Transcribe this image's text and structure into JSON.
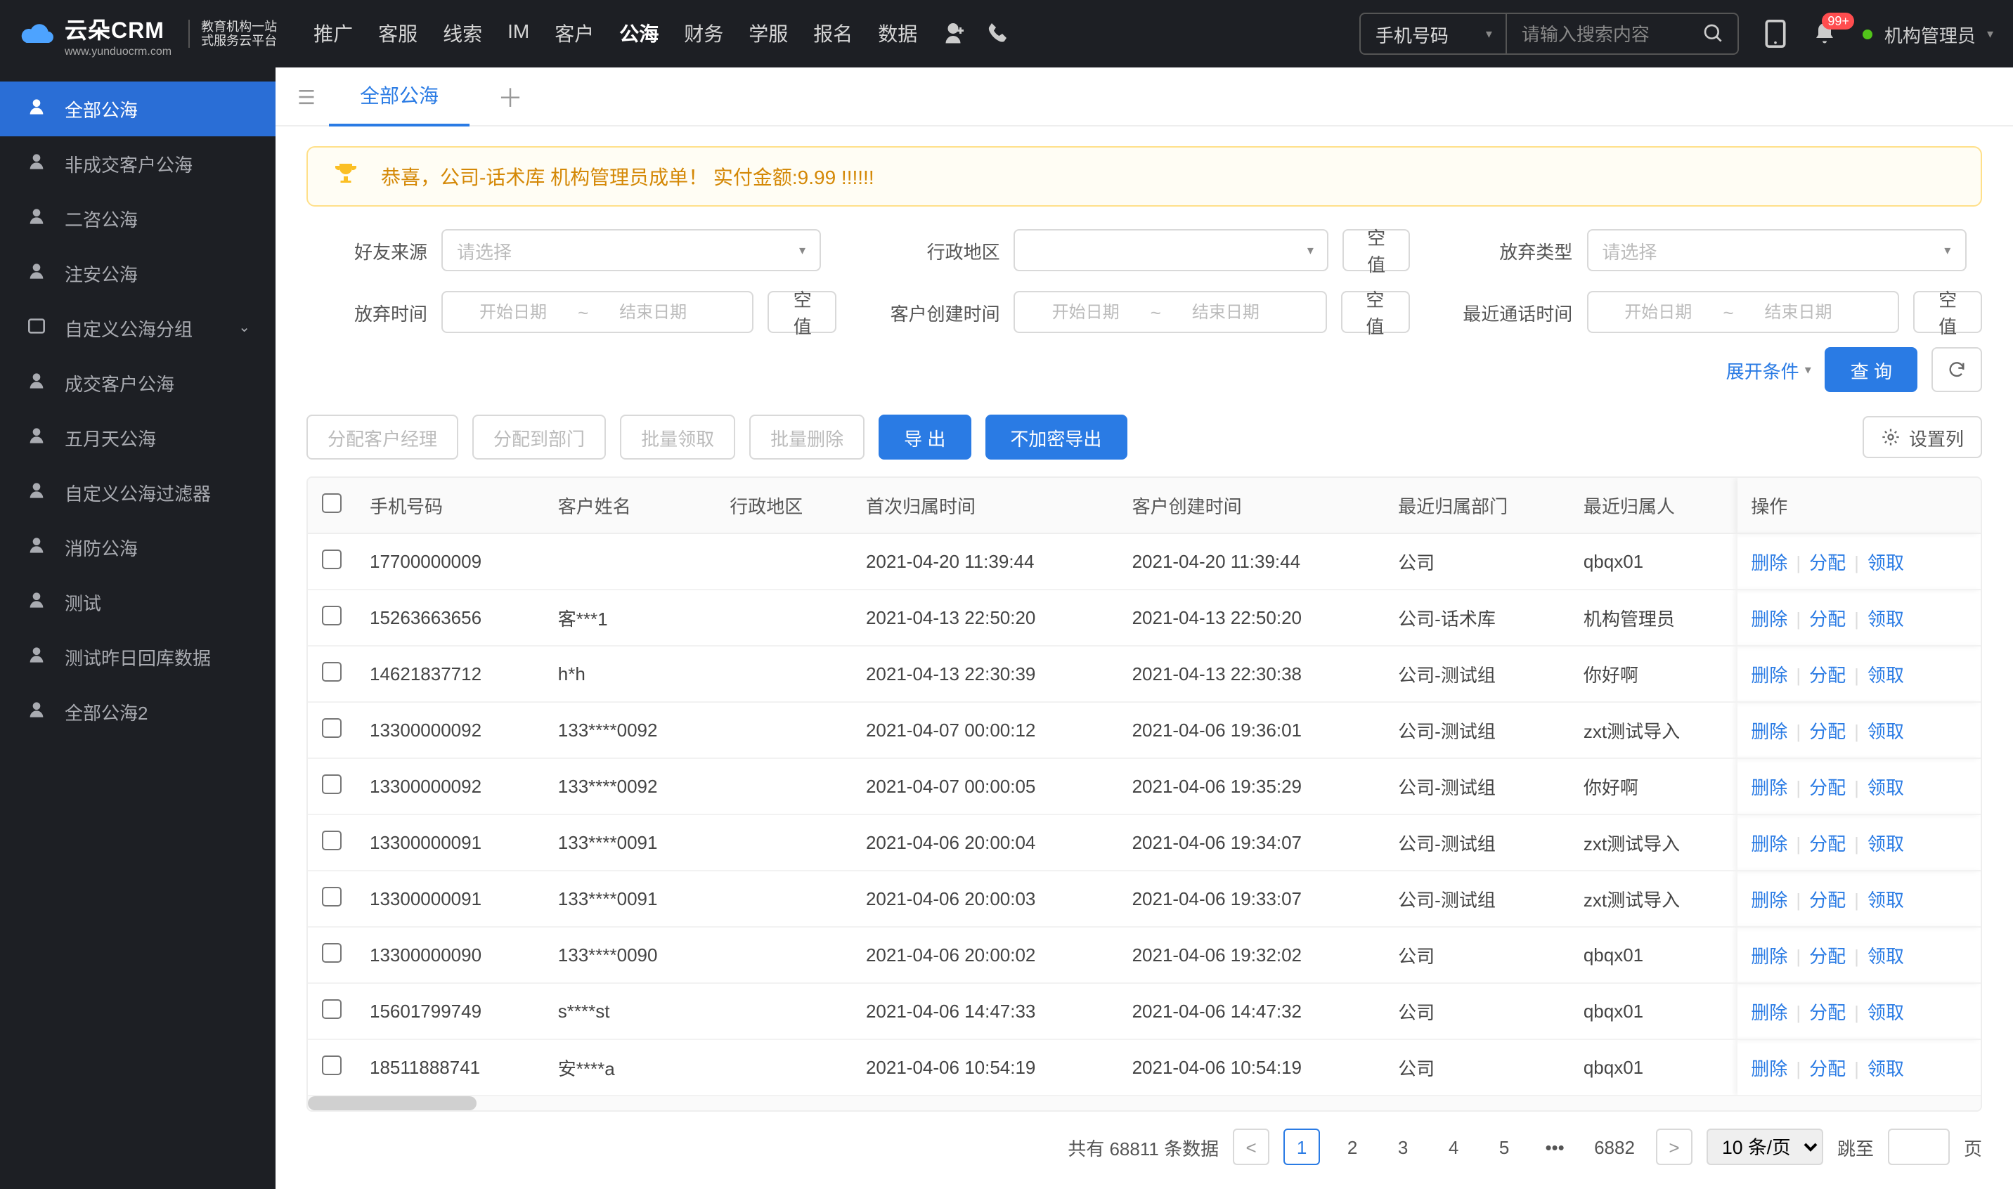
{
  "header": {
    "brand": "云朵CRM",
    "brand_url": "www.yunduocrm.com",
    "brand_sub1": "教育机构一站",
    "brand_sub2": "式服务云平台",
    "nav": [
      "推广",
      "客服",
      "线索",
      "IM",
      "客户",
      "公海",
      "财务",
      "学服",
      "报名",
      "数据"
    ],
    "nav_active": 5,
    "search_type": "手机号码",
    "search_placeholder": "请输入搜索内容",
    "notif_badge": "99+",
    "user_name": "机构管理员"
  },
  "sidebar": {
    "items": [
      {
        "label": "全部公海",
        "active": true
      },
      {
        "label": "非成交客户公海"
      },
      {
        "label": "二咨公海"
      },
      {
        "label": "注安公海"
      },
      {
        "label": "自定义公海分组",
        "expandable": true
      },
      {
        "label": "成交客户公海"
      },
      {
        "label": "五月天公海"
      },
      {
        "label": "自定义公海过滤器"
      },
      {
        "label": "消防公海"
      },
      {
        "label": "测试"
      },
      {
        "label": "测试昨日回库数据"
      },
      {
        "label": "全部公海2"
      }
    ]
  },
  "tabs": {
    "active_label": "全部公海"
  },
  "banner": {
    "text": "恭喜，公司-话术库  机构管理员成单！  实付金额:9.99 !!!!!!"
  },
  "filters": {
    "friend_source_label": "好友来源",
    "region_label": "行政地区",
    "abandon_type_label": "放弃类型",
    "abandon_time_label": "放弃时间",
    "create_time_label": "客户创建时间",
    "last_call_label": "最近通话时间",
    "placeholder_select": "请选择",
    "start_date": "开始日期",
    "end_date": "结束日期",
    "empty_btn": "空值",
    "expand": "展开条件",
    "query": "查 询"
  },
  "actions": {
    "assign_mgr": "分配客户经理",
    "assign_dept": "分配到部门",
    "batch_claim": "批量领取",
    "batch_delete": "批量删除",
    "export": "导 出",
    "export_plain": "不加密导出",
    "set_cols": "设置列"
  },
  "table": {
    "columns": [
      "手机号码",
      "客户姓名",
      "行政地区",
      "首次归属时间",
      "客户创建时间",
      "最近归属部门",
      "最近归属人",
      "操作"
    ],
    "op_labels": {
      "delete": "删除",
      "assign": "分配",
      "claim": "领取"
    },
    "rows": [
      {
        "phone": "17700000009",
        "name": "",
        "region": "",
        "first": "2021-04-20 11:39:44",
        "created": "2021-04-20 11:39:44",
        "dept": "公司",
        "owner": "qbqx01"
      },
      {
        "phone": "15263663656",
        "name": "客***1",
        "region": "",
        "first": "2021-04-13 22:50:20",
        "created": "2021-04-13 22:50:20",
        "dept": "公司-话术库",
        "owner": "机构管理员"
      },
      {
        "phone": "14621837712",
        "name": "h*h",
        "region": "",
        "first": "2021-04-13 22:30:39",
        "created": "2021-04-13 22:30:38",
        "dept": "公司-测试组",
        "owner": "你好啊"
      },
      {
        "phone": "13300000092",
        "name": "133****0092",
        "region": "",
        "first": "2021-04-07 00:00:12",
        "created": "2021-04-06 19:36:01",
        "dept": "公司-测试组",
        "owner": "zxt测试导入"
      },
      {
        "phone": "13300000092",
        "name": "133****0092",
        "region": "",
        "first": "2021-04-07 00:00:05",
        "created": "2021-04-06 19:35:29",
        "dept": "公司-测试组",
        "owner": "你好啊"
      },
      {
        "phone": "13300000091",
        "name": "133****0091",
        "region": "",
        "first": "2021-04-06 20:00:04",
        "created": "2021-04-06 19:34:07",
        "dept": "公司-测试组",
        "owner": "zxt测试导入"
      },
      {
        "phone": "13300000091",
        "name": "133****0091",
        "region": "",
        "first": "2021-04-06 20:00:03",
        "created": "2021-04-06 19:33:07",
        "dept": "公司-测试组",
        "owner": "zxt测试导入"
      },
      {
        "phone": "13300000090",
        "name": "133****0090",
        "region": "",
        "first": "2021-04-06 20:00:02",
        "created": "2021-04-06 19:32:02",
        "dept": "公司",
        "owner": "qbqx01"
      },
      {
        "phone": "15601799749",
        "name": "s****st",
        "region": "",
        "first": "2021-04-06 14:47:33",
        "created": "2021-04-06 14:47:32",
        "dept": "公司",
        "owner": "qbqx01"
      },
      {
        "phone": "18511888741",
        "name": "安****a",
        "region": "",
        "first": "2021-04-06 10:54:19",
        "created": "2021-04-06 10:54:19",
        "dept": "公司",
        "owner": "qbqx01"
      }
    ]
  },
  "pagination": {
    "total_prefix": "共有",
    "total": "68811",
    "total_suffix": "条数据",
    "pages": [
      "1",
      "2",
      "3",
      "4",
      "5"
    ],
    "last_page": "6882",
    "current": 1,
    "per_page": "10 条/页",
    "jump_label": "跳至",
    "page_suffix": "页"
  }
}
